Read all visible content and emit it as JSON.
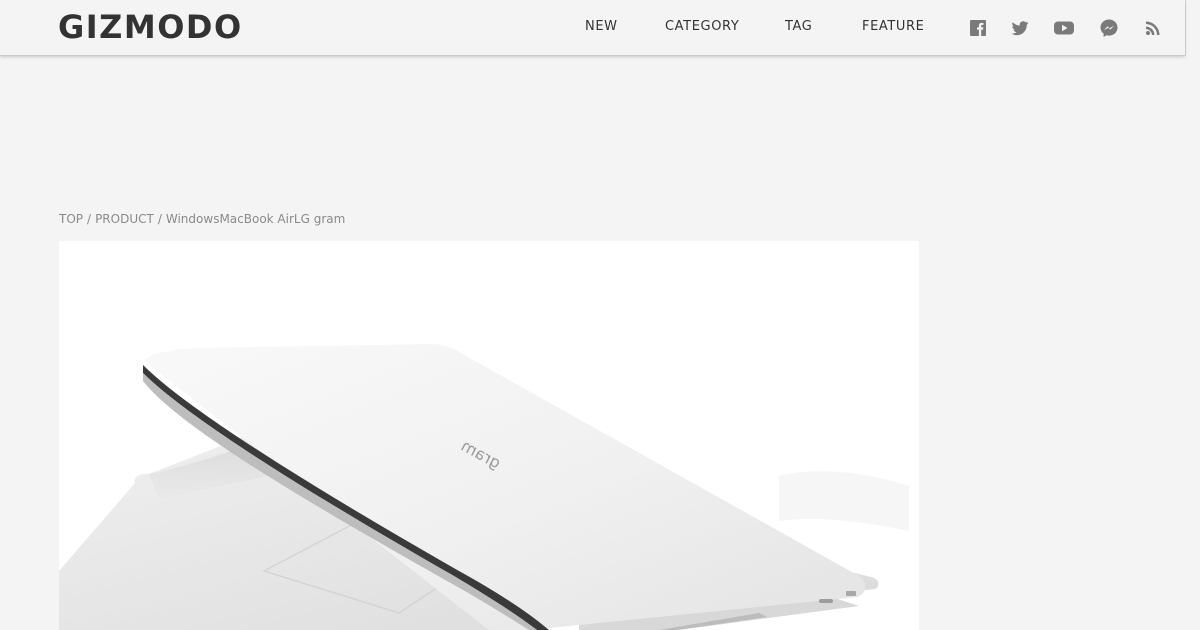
{
  "header": {
    "logo": "GIZMODO",
    "nav": [
      {
        "label": "NEW"
      },
      {
        "label": "CATEGORY"
      },
      {
        "label": "TAG"
      },
      {
        "label": "FEATURE"
      }
    ],
    "social": [
      "facebook-icon",
      "twitter-icon",
      "youtube-icon",
      "messenger-icon",
      "rss-icon"
    ]
  },
  "breadcrumb": {
    "items": [
      "TOP",
      "PRODUCT",
      "WindowsMacBook AirLG gram"
    ],
    "separator": "/"
  },
  "hero": {
    "image_name": "lg-gram-laptop-image",
    "lid_logo": "gram"
  },
  "colors": {
    "background": "#f4f4f4",
    "text": "#333333",
    "muted": "#8a8a8a",
    "icon": "#7a7a7a"
  }
}
